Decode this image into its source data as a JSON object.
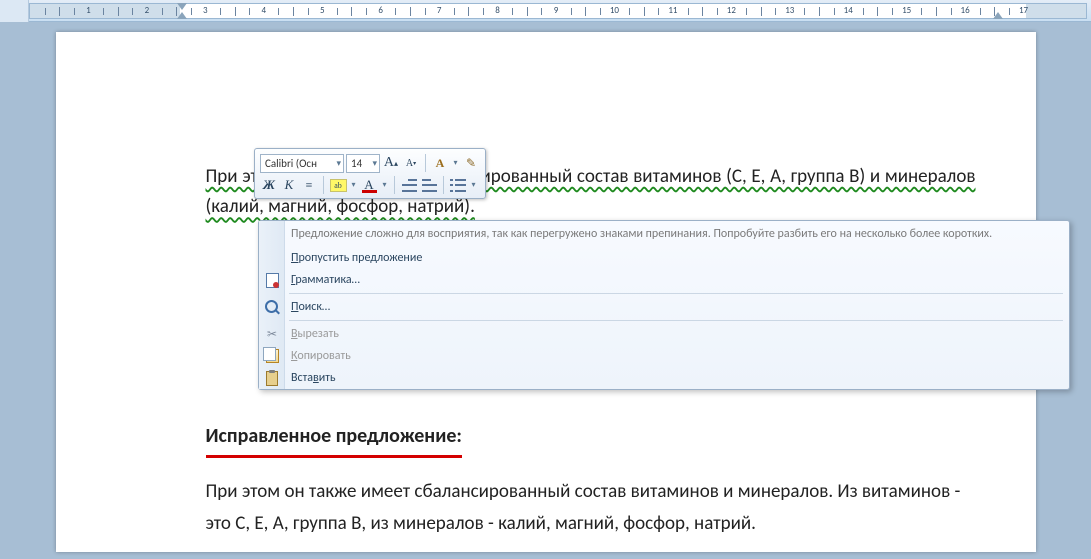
{
  "ruler": {
    "max_cm": 18
  },
  "document": {
    "para1": "При этом он также имеет сбалансированный состав витаминов (С, Е, А, группа В) и минералов (калий, магний, фосфор, натрий).",
    "heading": "Исправленное предложение:",
    "para2": "При этом он также имеет сбалансированный состав витаминов и минералов. Из витаминов - это С, Е, А, группа В, из минералов - калий, магний, фосфор, натрий."
  },
  "mini_toolbar": {
    "font_name": "Calibri (Осн",
    "font_size": "14",
    "grow_font": "A",
    "shrink_font": "A",
    "styles_label": "A",
    "format_painter": "✎",
    "bold": "Ж",
    "italic": "К",
    "center_glyph": "≡",
    "font_color_glyph": "A"
  },
  "context_menu": {
    "suggestion": "Предложение сложно для восприятия, так как перегружено знаками препинания. Попробуйте разбить его на несколько более коротких.",
    "skip": "Пропустить предложение",
    "grammar": "Грамматика…",
    "search": "Поиск…",
    "cut": "Вырезать",
    "copy": "Копировать",
    "paste": "Вставить",
    "cut_key": "В",
    "copy_key": "К",
    "paste_key": "в",
    "skip_key": "П",
    "grammar_key": "Г",
    "search_key": "П"
  }
}
